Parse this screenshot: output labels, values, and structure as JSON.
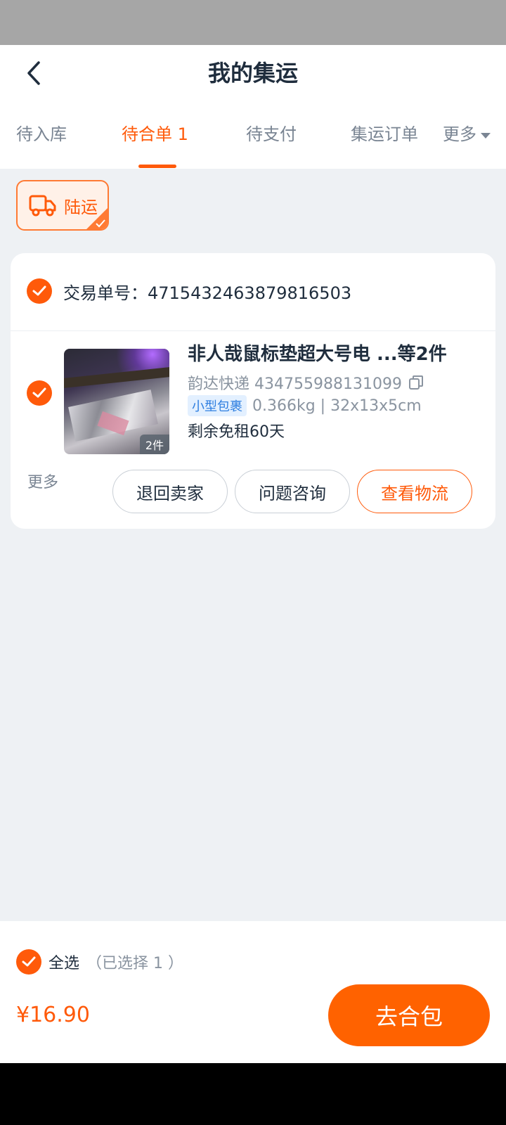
{
  "header": {
    "title": "我的集运",
    "back_icon": "chevron-left-icon"
  },
  "tabs": [
    {
      "label": "待入库",
      "active": false
    },
    {
      "label": "待合单 1",
      "active": true
    },
    {
      "label": "待支付",
      "active": false
    },
    {
      "label": "集运订单",
      "active": false
    },
    {
      "label": "更多",
      "active": false
    }
  ],
  "shipping_mode": {
    "label": "陆运",
    "icon": "truck-icon",
    "selected": true
  },
  "order": {
    "number_label": "交易单号：4715432463879816503",
    "selected": true,
    "item": {
      "title": "非人哉鼠标垫超大号电 ...等2件",
      "courier": "韵达快递 434755988131099",
      "size_tag": "小型包裹",
      "weight_dims": "0.366kg | 32x13x5cm",
      "free_days": "剩余免租60天",
      "count_badge": "2件",
      "selected": true
    },
    "actions": {
      "more": "更多",
      "return": "退回卖家",
      "inquiry": "问题咨询",
      "logistics": "查看物流"
    }
  },
  "footer": {
    "select_all": "全选",
    "selected_count": "（已选择 1 ）",
    "price": "¥16.90",
    "submit": "去合包"
  },
  "colors": {
    "accent": "#ff5a0a",
    "tag_blue": "#2f7fe0",
    "background": "#eef1f4"
  }
}
